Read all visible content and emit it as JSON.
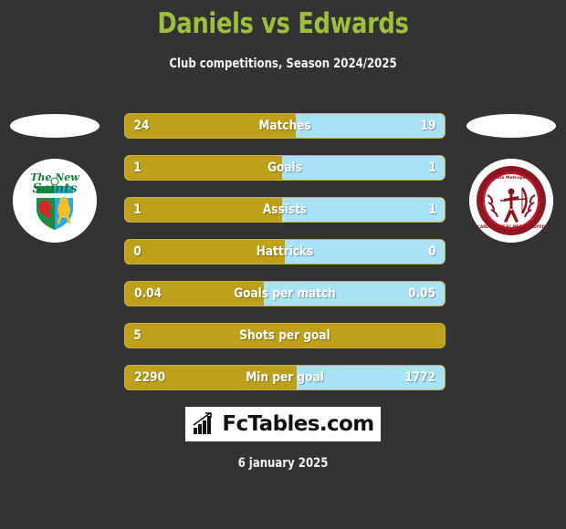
{
  "header": {
    "title": "Daniels vs Edwards",
    "subtitle": "Club competitions, Season 2024/2025",
    "title_color": "#9ac03c"
  },
  "teams": {
    "home": {
      "name": "The New Saints",
      "crest_name": "the-new-saints-crest",
      "crest_text_line1": "The New",
      "crest_text_line2": "Saints",
      "color": "#bfa01a"
    },
    "away": {
      "name": "Cardiff Met FC",
      "crest_name": "cardiff-met-fc-crest",
      "crest_text_top": "Corydin Metropolitan",
      "crest_text_bottom": "CARDIFF MET FC MET CAERDYDD",
      "color": "#a7e2f7"
    }
  },
  "stats": [
    {
      "label": "Matches",
      "home": "24",
      "away": "19",
      "home_pct": 53.5
    },
    {
      "label": "Goals",
      "home": "1",
      "away": "1",
      "home_pct": 49.0
    },
    {
      "label": "Assists",
      "home": "1",
      "away": "1",
      "home_pct": 49.0
    },
    {
      "label": "Hattricks",
      "home": "0",
      "away": "0",
      "home_pct": 50.0
    },
    {
      "label": "Goals per match",
      "home": "0.04",
      "away": "0.05",
      "home_pct": 43.5
    },
    {
      "label": "Shots per goal",
      "home": "5",
      "away": "",
      "home_pct": 100.0
    },
    {
      "label": "Min per goal",
      "home": "2290",
      "away": "1772",
      "home_pct": 53.7
    }
  ],
  "footer": {
    "brand_name": "FcTables.com",
    "brand_icon": "bar-chart-icon",
    "date": "6 january 2025"
  },
  "colors": {
    "background": "#333333",
    "home_bar": "#bfa01a",
    "away_bar": "#a7e2f7",
    "bar_border": "#c9b23a",
    "title": "#9ac03c",
    "text": "#ffffff"
  }
}
